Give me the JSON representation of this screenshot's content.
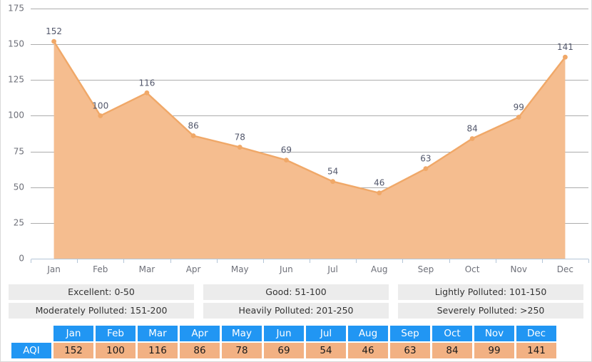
{
  "chart_data": {
    "type": "area",
    "title": "",
    "xlabel": "",
    "ylabel": "",
    "categories": [
      "Jan",
      "Feb",
      "Mar",
      "Apr",
      "May",
      "Jun",
      "Jul",
      "Aug",
      "Sep",
      "Oct",
      "Nov",
      "Dec"
    ],
    "series": [
      {
        "name": "AQI",
        "values": [
          152,
          100,
          116,
          86,
          78,
          69,
          54,
          46,
          63,
          84,
          99,
          141
        ]
      }
    ],
    "values": [
      152,
      100,
      116,
      86,
      78,
      69,
      54,
      46,
      63,
      84,
      99,
      141
    ],
    "ylim": [
      0,
      175
    ],
    "yticks": [
      0,
      25,
      50,
      75,
      100,
      125,
      150,
      175
    ],
    "ytick_labels": [
      "0",
      "25",
      "50",
      "75",
      "100",
      "125",
      "150",
      "175"
    ],
    "grid": true,
    "legend_position": "none",
    "show_point_labels": true,
    "colors": {
      "area_fill": "#f5bd8f",
      "line": "#f0a868",
      "point": "#f0a868",
      "gridline": "#adadad",
      "axis": "#b4c6d8",
      "tick_text": "#6e7079",
      "point_label_text": "#52576b"
    }
  },
  "legend": {
    "items": [
      {
        "label": "Excellent: 0-50"
      },
      {
        "label": "Good: 51-100"
      },
      {
        "label": "Lightly Polluted: 101-150"
      },
      {
        "label": "Moderately Polluted: 151-200"
      },
      {
        "label": "Heavily Polluted: 201-250"
      },
      {
        "label": "Severely Polluted: >250"
      }
    ]
  },
  "table": {
    "corner_label": "",
    "row_label": "AQI",
    "headers": [
      "Jan",
      "Feb",
      "Mar",
      "Apr",
      "May",
      "Jun",
      "Jul",
      "Aug",
      "Sep",
      "Oct",
      "Nov",
      "Dec"
    ],
    "values": [
      "152",
      "100",
      "116",
      "86",
      "78",
      "69",
      "54",
      "46",
      "63",
      "84",
      "99",
      "141"
    ],
    "colors": {
      "header_bg": "#2196f3",
      "header_text": "#ffffff",
      "value_bg": "#f2b183",
      "value_text": "#1a1a1a"
    }
  }
}
